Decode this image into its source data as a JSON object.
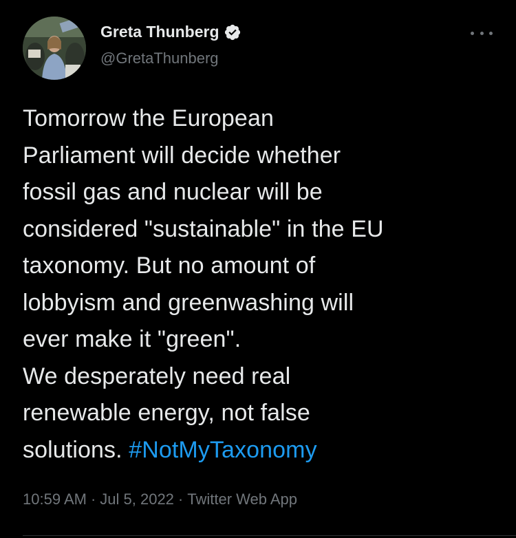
{
  "author": {
    "display_name": "Greta Thunberg",
    "handle": "@GretaThunberg",
    "verified": true,
    "avatar_icon": "profile-photo"
  },
  "more_icon": "more-horizontal-icon",
  "tweet": {
    "lines": [
      "Tomorrow the European",
      "Parliament will decide whether",
      "fossil gas and nuclear will be",
      "considered \"sustainable\" in the EU",
      "taxonomy. But no amount of",
      "lobbyism and greenwashing will",
      "ever make it \"green\".",
      "We desperately need real",
      "renewable energy, not false"
    ],
    "last_line_text": "solutions. ",
    "hashtag": "#NotMyTaxonomy"
  },
  "meta": {
    "time": "10:59 AM",
    "date": "Jul 5, 2022",
    "source": "Twitter Web App",
    "separator": "·"
  },
  "colors": {
    "background": "#000000",
    "text": "#e7e9ea",
    "secondary": "#71767b",
    "accent": "#1d9bf0"
  }
}
